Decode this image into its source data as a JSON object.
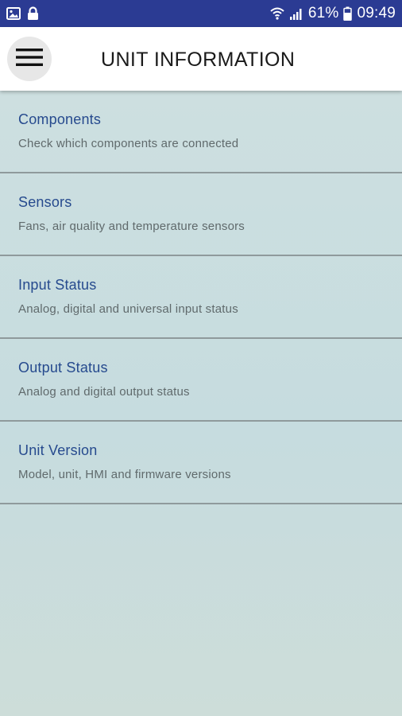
{
  "status_bar": {
    "battery_percent": "61%",
    "time": "09:49",
    "icons": [
      "gallery-icon",
      "lock-icon",
      "wifi-icon",
      "signal-icon",
      "battery-icon"
    ]
  },
  "header": {
    "title": "UNIT INFORMATION",
    "menu_icon": "hamburger-menu-icon"
  },
  "menu": {
    "items": [
      {
        "title": "Components",
        "subtitle": "Check which components are connected"
      },
      {
        "title": "Sensors",
        "subtitle": "Fans, air quality and temperature sensors"
      },
      {
        "title": "Input Status",
        "subtitle": "Analog, digital and universal input status"
      },
      {
        "title": "Output Status",
        "subtitle": "Analog and digital output status"
      },
      {
        "title": "Unit Version",
        "subtitle": "Model, unit, HMI and firmware versions"
      }
    ]
  },
  "colors": {
    "status_bar": "#2b3b93",
    "title_text": "#264a8e",
    "subtitle_text": "#606a6c",
    "divider": "#8f9a9c"
  }
}
